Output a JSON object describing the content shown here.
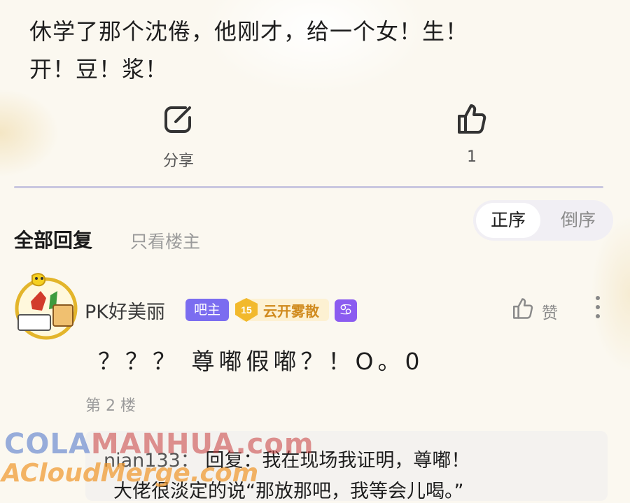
{
  "post": {
    "line1": "休学了那个沈倦，他刚才，给一个女！生！",
    "line2": "开！豆！浆！"
  },
  "actions": {
    "share_label": "分享",
    "like_count": "1"
  },
  "replies_header": {
    "all_label": "全部回复",
    "op_only_label": "只看楼主",
    "sort_asc": "正序",
    "sort_desc": "倒序"
  },
  "reply": {
    "username": "PK好美丽",
    "owner_badge": "吧主",
    "level": "15",
    "level_title": "云开雾散",
    "zodiac": "♋",
    "like_label": "赞",
    "content": "？？？ 尊嘟假嘟？！O。0",
    "floor": "第 2 楼",
    "sub_reply": {
      "user": "nian133：",
      "line1_text": "回复：我在现场我证明，尊嘟！",
      "line2_text": "大佬很淡定的说“那放那吧，我等会儿喝。”"
    }
  },
  "watermarks": {
    "line1a": "COLA",
    "line1b": "MANHUA.com",
    "line2": "ACloudMerge.com"
  },
  "colors": {
    "accent": "#7b6df0",
    "level_gold": "#d08a1d",
    "divider": "#c9c7e0"
  },
  "icons": [
    "share-icon",
    "thumbs-up-icon",
    "more-vertical-icon"
  ]
}
